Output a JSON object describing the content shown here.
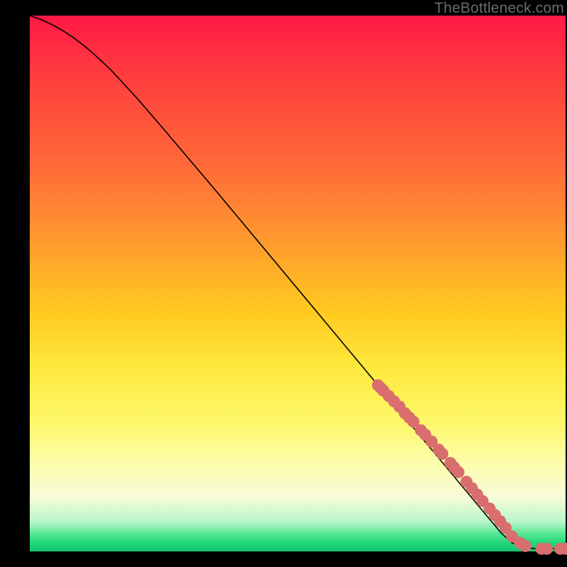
{
  "watermark": "TheBottleneck.com",
  "colors": {
    "background": "#000000",
    "marker": "#da6e6e",
    "line": "#000000"
  },
  "chart_data": {
    "type": "line",
    "title": "",
    "xlabel": "",
    "ylabel": "",
    "xlim": [
      0,
      100
    ],
    "ylim": [
      0,
      100
    ],
    "grid": false,
    "annotations": [
      "TheBottleneck.com"
    ],
    "series": [
      {
        "name": "curve",
        "x": [
          0,
          2,
          4,
          6,
          8,
          10,
          12,
          15,
          20,
          25,
          30,
          35,
          40,
          45,
          50,
          55,
          60,
          65,
          70,
          75,
          80,
          85,
          88,
          90,
          91,
          92,
          93,
          94,
          95,
          96,
          97,
          98,
          99,
          100
        ],
        "y": [
          100,
          99.3,
          98.4,
          97.3,
          96.0,
          94.5,
          92.8,
          90.0,
          84.6,
          78.8,
          72.9,
          67.0,
          61.0,
          55.0,
          49.0,
          43.0,
          37.0,
          31.0,
          25.0,
          19.0,
          13.0,
          7.0,
          3.4,
          1.6,
          1.1,
          0.8,
          0.65,
          0.55,
          0.5,
          0.5,
          0.5,
          0.5,
          0.5,
          0.5
        ]
      }
    ],
    "markers": {
      "name": "datapoints",
      "x": [
        65.0,
        65.5,
        66.0,
        67.0,
        68.0,
        69.0,
        70.0,
        70.8,
        71.6,
        73.0,
        73.8,
        75.0,
        76.3,
        77.0,
        78.5,
        79.2,
        80.0,
        81.5,
        82.5,
        83.5,
        84.5,
        85.8,
        86.8,
        87.8,
        88.8,
        90.0,
        91.5,
        92.5,
        95.5,
        96.5,
        99.0,
        100.0
      ],
      "y": [
        31.0,
        30.5,
        30.0,
        29.0,
        28.0,
        27.0,
        25.8,
        25.0,
        24.2,
        22.6,
        21.8,
        20.5,
        19.0,
        18.2,
        16.5,
        15.7,
        14.8,
        13.0,
        11.8,
        10.6,
        9.4,
        8.0,
        6.8,
        5.6,
        4.4,
        2.8,
        1.6,
        1.0,
        0.5,
        0.5,
        0.5,
        0.5
      ]
    }
  }
}
